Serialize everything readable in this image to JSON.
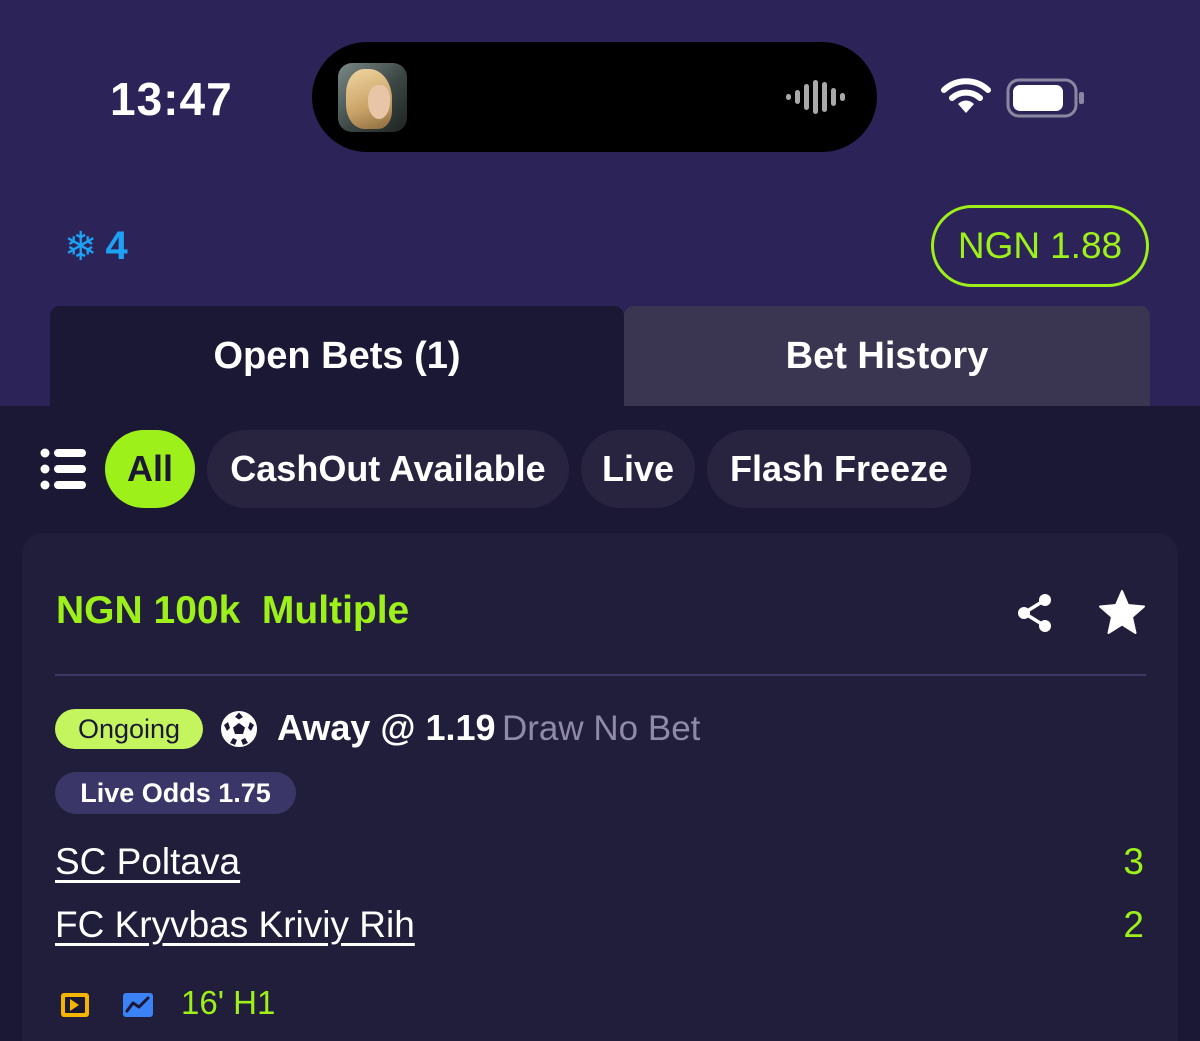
{
  "status_bar": {
    "time": "13:47",
    "icons": [
      "album-art",
      "waveform-icon",
      "wifi-icon",
      "battery-icon"
    ]
  },
  "header": {
    "freeze_icon": "snowflake-icon",
    "freeze_symbol": "❄",
    "freeze_count": "4",
    "balance_currency": "NGN",
    "balance_value": "1.88",
    "accent_color": "#9ef01a",
    "freeze_color": "#1da1f2"
  },
  "tabs": {
    "open_bets": "Open Bets (1)",
    "bet_history": "Bet History"
  },
  "filters": {
    "menu_icon": "list-icon",
    "all": "All",
    "cashout": "CashOut Available",
    "live": "Live",
    "flash_freeze": "Flash Freeze"
  },
  "bet": {
    "title": "NGN 100k  Multiple",
    "status": "Ongoing",
    "sport_icon": "soccer-ball-icon",
    "selection": "Away @ 1.19",
    "market": "Draw No Bet",
    "live_odds": "Live Odds 1.75",
    "home_team": "SC Poltava",
    "home_score": "3",
    "away_team": "FC Kryvbas Kriviy Rih",
    "away_score": "2",
    "match_time": "16' H1",
    "icons": [
      "share-icon",
      "star-icon",
      "live-stream-icon",
      "stats-icon"
    ]
  }
}
